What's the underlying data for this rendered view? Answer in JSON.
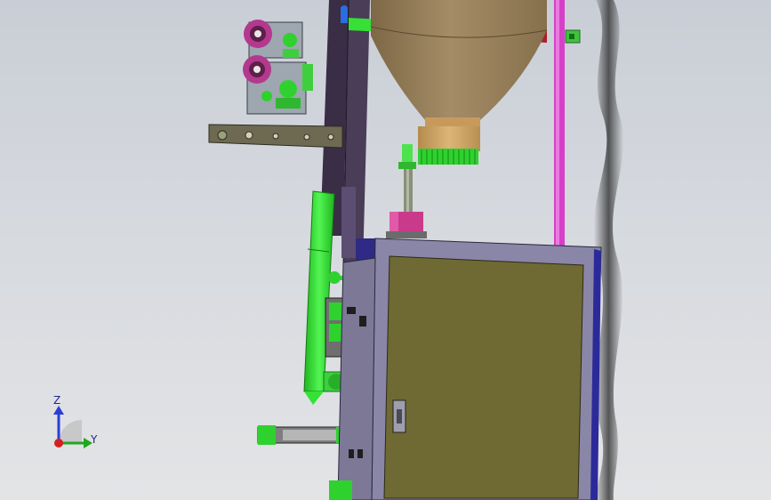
{
  "viewport": {
    "background_top": "#c9ced6",
    "background_bottom": "#e3e4e6"
  },
  "model": {
    "colors": {
      "frame": "#3b2f45",
      "hopper": "#9c8563",
      "hopper_collar": "#d3a96a",
      "cabinet_frame": "#8a86a8",
      "cabinet_door": "#6f6a33",
      "pipe": "#d640c8",
      "green": "#33e233",
      "magenta": "#c93a8a",
      "red_bar": "#b21e2a",
      "bracket": "#6e6a52"
    },
    "parts": [
      "hopper-cone",
      "hopper-collar",
      "brush-feeder",
      "dosing-shaft",
      "dosing-motor",
      "vertical-frame",
      "support-arm",
      "film-reel-upper",
      "film-reel-lower",
      "forming-tube",
      "sealing-jaw-assembly",
      "cutter-cylinder",
      "control-cabinet",
      "cabinet-door",
      "door-handle",
      "pneumatic-pipe",
      "smoke-trail"
    ]
  },
  "triad": {
    "z_label": "Z",
    "y_label": "Y",
    "z_color": "#2a3fd6",
    "y_color": "#1fa81f",
    "x_color": "#d61f1f"
  }
}
